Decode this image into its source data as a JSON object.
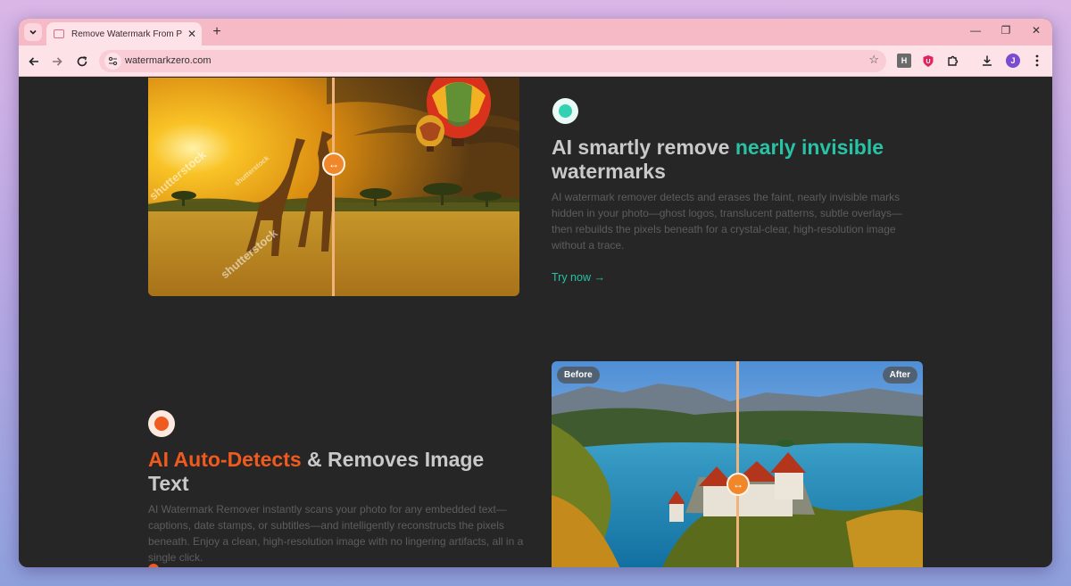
{
  "browser": {
    "tab_title": "Remove Watermark From Photo",
    "close_tab": "✕",
    "new_tab": "+",
    "url": "watermarkzero.com",
    "profile_initial": "J",
    "ext_h": "H",
    "minimize": "—",
    "restore": "❐",
    "close_window": "✕"
  },
  "section1": {
    "heading_part1": "AI smartly remove ",
    "heading_highlight": "nearly invisible",
    "heading_part2": "watermarks",
    "body": "AI watermark remover detects and erases the faint, nearly invisible marks hidden in your photo—ghost logos, translucent patterns, subtle overlays—then rebuilds the pixels beneath for a crystal-clear, high-resolution image without a trace.",
    "cta": "Try now →",
    "watermark_text": "shutterstock"
  },
  "section2": {
    "heading_highlight": "AI Auto-Detects",
    "heading_part2": " & Removes Image",
    "heading_part3": "Text",
    "body": "AI Watermark Remover instantly scans your photo for any embedded text—captions, date stamps, or subtitles—and intelligently reconstructs the pixels beneath. Enjoy a clean, high-resolution image with no lingering artifacts, all in a single click.",
    "before_label": "Before",
    "after_label": "After"
  },
  "colors": {
    "teal_accent": "#27c3a4",
    "orange_accent": "#f05a1e",
    "page_bg": "#262626",
    "tabstrip": "#f6b9c6"
  },
  "icons": [
    "chevron-down-icon",
    "back-arrow-icon",
    "forward-arrow-icon",
    "reload-icon",
    "site-settings-icon",
    "star-icon",
    "extensions-icon",
    "download-icon",
    "menu-icon",
    "drag-handle-icon"
  ]
}
